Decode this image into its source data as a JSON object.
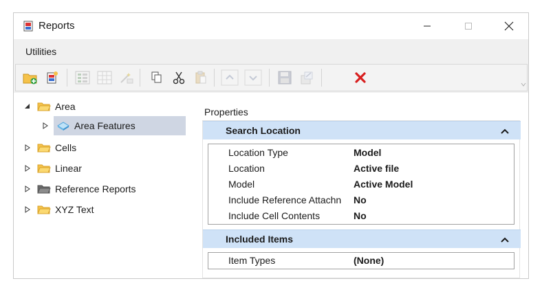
{
  "window": {
    "title": "Reports"
  },
  "menu": {
    "items": [
      {
        "label": "Utilities"
      }
    ]
  },
  "toolbar": {
    "buttons": [
      {
        "icon": "new-folder-icon",
        "enabled": true
      },
      {
        "icon": "new-report-icon",
        "enabled": true
      },
      {
        "icon": "list-view-icon",
        "enabled": false
      },
      {
        "icon": "grid-view-icon",
        "enabled": false
      },
      {
        "icon": "wand-icon",
        "enabled": false
      },
      {
        "icon": "copy-icon",
        "enabled": true
      },
      {
        "icon": "cut-icon",
        "enabled": true
      },
      {
        "icon": "paste-icon",
        "enabled": false
      },
      {
        "icon": "move-up-icon",
        "enabled": false
      },
      {
        "icon": "move-down-icon",
        "enabled": false
      },
      {
        "icon": "save-icon",
        "enabled": false
      },
      {
        "icon": "export-icon",
        "enabled": false
      },
      {
        "icon": "delete-icon",
        "enabled": true
      }
    ]
  },
  "tree": {
    "items": [
      {
        "label": "Area",
        "expanded": true
      },
      {
        "label": "Area Features",
        "selected": true
      },
      {
        "label": "Cells"
      },
      {
        "label": "Linear"
      },
      {
        "label": "Reference Reports"
      },
      {
        "label": "XYZ Text"
      }
    ]
  },
  "properties": {
    "title": "Properties",
    "sections": [
      {
        "title": "Search Location",
        "rows": [
          {
            "name": "Location Type",
            "value": "Model"
          },
          {
            "name": "Location",
            "value": "Active file"
          },
          {
            "name": "Model",
            "value": "Active Model"
          },
          {
            "name": "Include Reference Attachn",
            "value": "No"
          },
          {
            "name": "Include Cell Contents",
            "value": "No"
          }
        ]
      },
      {
        "title": "Included Items",
        "rows": [
          {
            "name": "Item Types",
            "value": "(None)"
          }
        ]
      }
    ]
  },
  "colors": {
    "accent": "#cfe2f7",
    "selection": "#cfd6e3",
    "folder": "#f5c24a",
    "delete": "#d81e1e"
  }
}
